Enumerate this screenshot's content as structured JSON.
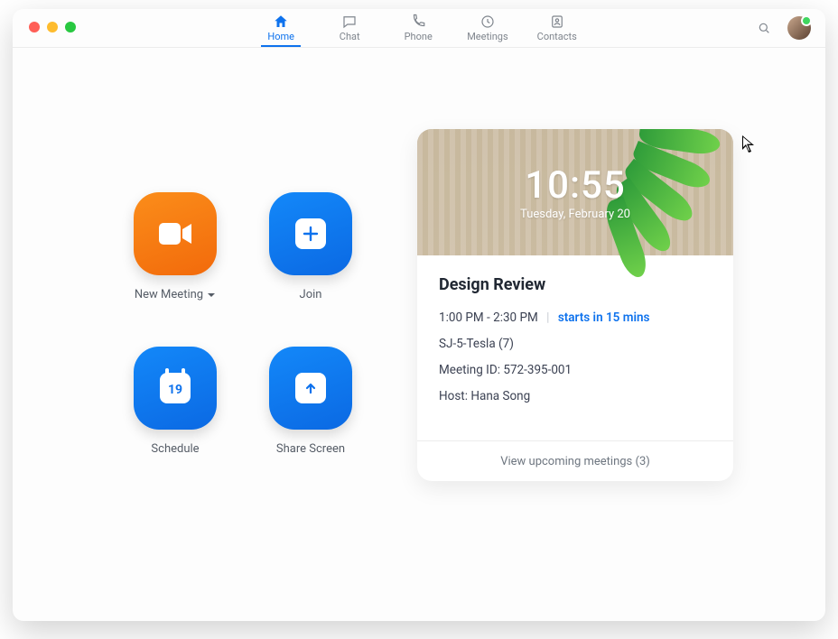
{
  "tabs": {
    "home": "Home",
    "chat": "Chat",
    "phone": "Phone",
    "meetings": "Meetings",
    "contacts": "Contacts"
  },
  "actions": {
    "newMeeting": "New Meeting",
    "join": "Join",
    "schedule": "Schedule",
    "shareScreen": "Share Screen",
    "calendarDay": "19"
  },
  "clock": {
    "time": "10:55",
    "date": "Tuesday, February 20"
  },
  "meeting": {
    "title": "Design Review",
    "timeRange": "1:00 PM - 2:30 PM",
    "starts": "starts in 15 mins",
    "room": "SJ-5-Tesla (7)",
    "idLabel": "Meeting ID:",
    "idValue": "572-395-001",
    "hostLabel": "Host:",
    "hostValue": "Hana Song"
  },
  "footer": {
    "upcoming": "View upcoming meetings (3)"
  },
  "colors": {
    "blue": "#0e72ed",
    "orange": "#f58220"
  }
}
